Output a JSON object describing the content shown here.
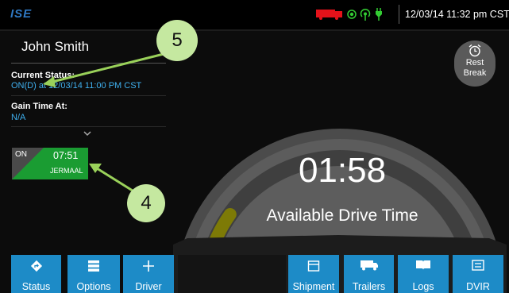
{
  "topbar": {
    "logo": "ISE",
    "datetime": "12/03/14 11:32 pm CST",
    "icons": [
      "truck-icon",
      "gps-icon",
      "signal-icon",
      "plug-icon"
    ],
    "colors": {
      "truck": "#e4121a",
      "indicator": "#33cc33"
    }
  },
  "driver": {
    "name": "John Smith",
    "current_status_label": "Current Status:",
    "current_status_value": "ON(D) at 12/03/14 11:00 PM CST",
    "gain_time_label": "Gain Time At:",
    "gain_time_value": "N/A"
  },
  "status_card": {
    "code": "ON",
    "time": "07:51",
    "name": "JERMAAL",
    "color": "#1a9c32"
  },
  "gauge": {
    "time_value": "01:58",
    "label": "Available Drive Time",
    "fill_fraction": 0.12,
    "fill_color": "#7d7a06"
  },
  "rest_break": {
    "icon": "alarm-clock-icon",
    "label": "Rest\nBreak"
  },
  "callouts": {
    "five": "5",
    "four": "4",
    "color": "#c5e8a0"
  },
  "nav": {
    "status": "Status",
    "options": "Options",
    "driver": "Driver",
    "shipment": "Shipment",
    "trailers": "Trailers",
    "logs": "Logs",
    "dvir": "DVIR",
    "color": "#1d8bc7"
  }
}
